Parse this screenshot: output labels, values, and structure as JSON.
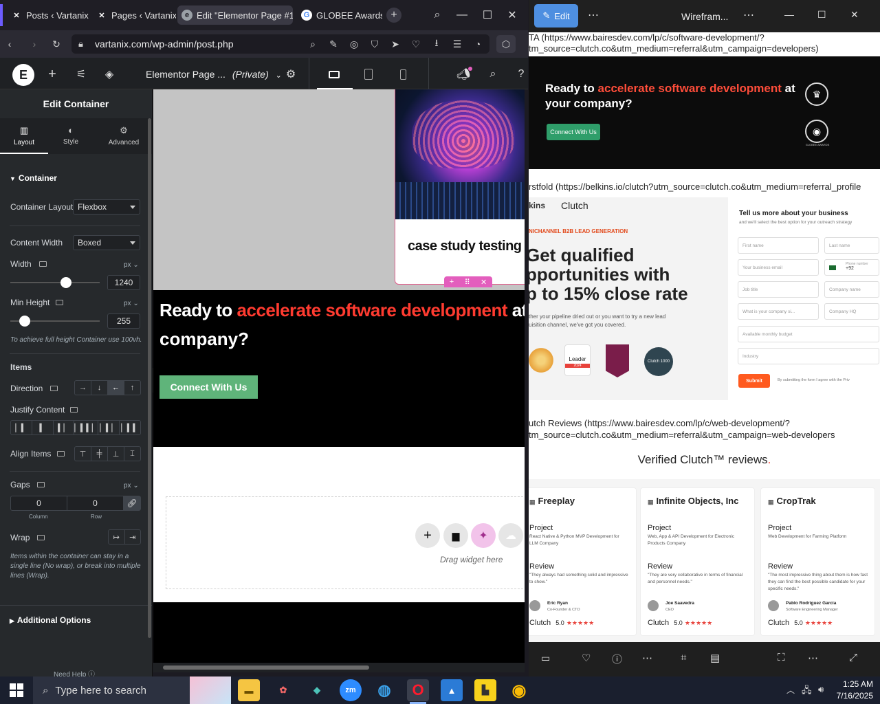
{
  "browser": {
    "tabs": [
      {
        "title": "Posts ‹ Vartanix —",
        "icon": "wordpress-icon"
      },
      {
        "title": "Pages ‹ Vartanix —",
        "icon": "wordpress-icon"
      },
      {
        "title": "Edit \"Elementor Page #10",
        "icon": "elementor-icon"
      },
      {
        "title": "GLOBEE Awards Ir",
        "icon": "google-icon"
      }
    ],
    "url": "vartanix.com/wp-admin/post.php"
  },
  "elementor": {
    "page_title": "Elementor Page ...",
    "page_status": "(Private)",
    "panel": {
      "title": "Edit Container",
      "tabs": [
        "Layout",
        "Style",
        "Advanced"
      ],
      "section": "Container",
      "container_layout_label": "Container Layout",
      "container_layout_value": "Flexbox",
      "content_width_label": "Content Width",
      "content_width_value": "Boxed",
      "width_label": "Width",
      "width_unit": "px",
      "width_value": "1240",
      "width_fraction": 0.62,
      "min_height_label": "Min Height",
      "min_height_unit": "px",
      "min_height_value": "255",
      "min_height_fraction": 0.16,
      "min_height_hint": "To achieve full height Container use 100vh.",
      "items_heading": "Items",
      "direction_label": "Direction",
      "justify_label": "Justify Content",
      "align_label": "Align Items",
      "gaps_label": "Gaps",
      "gaps_unit": "px",
      "gap_column": "0",
      "gap_row": "0",
      "gap_column_label": "Column",
      "gap_row_label": "Row",
      "wrap_label": "Wrap",
      "wrap_hint": "Items within the container can stay in a single line (No wrap), or break into multiple lines (Wrap).",
      "additional_options": "Additional Options",
      "need_help": "Need Help"
    },
    "canvas": {
      "card_title": "case study testing",
      "cta_heading_pre": "Ready to ",
      "cta_heading_highlight": "accelerate software development",
      "cta_heading_post": " at y",
      "cta_heading_line2": "company?",
      "cta_button": "Connect With Us",
      "drag_hint": "Drag widget here"
    }
  },
  "viewer": {
    "title": "Wirefram...",
    "edit_label": "Edit",
    "cta_url_1": "TA (https://www.bairesdev.com/lp/c/software-development/?",
    "cta_url_2": "tm_source=clutch.co&utm_medium=referral&utm_campaign=developers)",
    "cta_heading_pre": "Ready to ",
    "cta_heading_highlight": "accelerate software development",
    "cta_heading_post": " at",
    "cta_heading_line2": "your company?",
    "cta_button": "Connect With Us",
    "globee_label": "GLOBEE AWARDS",
    "firstfold_url": "rstfold (https://belkins.io/clutch?utm_source=clutch.co&utm_medium=referral_profile",
    "brand": "Clutch",
    "brand_prefix": "kins",
    "eyebrow": "NICHANNEL B2B LEAD GENERATION",
    "hero_1": "Get qualified",
    "hero_2": "pportunities with",
    "hero_3": "p to 15% close rate",
    "hero_sub_1": "ther your pipeline dried out or you want to try a new lead",
    "hero_sub_2": "uisition channel, we've got you covered.",
    "badge_leader": "Leader",
    "badge_year": "2024",
    "badge_clutch": "Clutch 1000",
    "form_title": "Tell us more about your business",
    "form_sub": "and we'll select the best option for your outreach strategy",
    "form_fields": [
      "First name",
      "Last name",
      "Your business email",
      "Phone number",
      "Job title",
      "Company name",
      "What is your company si...",
      "Company HQ",
      "Available monthly budget",
      "Industry"
    ],
    "phone_code": "+92",
    "submit": "Submit",
    "consent": "By submitting the form I agree with the Priv",
    "reviews_url_1": "utch Reviews (https://www.bairesdev.com/lp/c/web-development/?",
    "reviews_url_2": "tm_source=clutch.co&utm_medium=referral&utm_campaign=web-developers",
    "reviews_heading": "Verified Clutch™ reviews",
    "reviews_dot": ".",
    "reviews": [
      {
        "company": "Freeplay",
        "project_label": "Project",
        "project": "React Native & Python MVP Development for LLM Company",
        "review_label": "Review",
        "review": "\"They always had something solid and impressive to show.\"",
        "name": "Eric Ryan",
        "role": "Co-Founder & CTO",
        "score": "5.0",
        "brand": "Clutch"
      },
      {
        "company": "Infinite Objects, Inc",
        "project_label": "Project",
        "project": "Web, App & API Development for Electronic Products Company",
        "review_label": "Review",
        "review": "\"They are very collaborative in terms of financial and personnel needs.\"",
        "name": "Joe Saavedra",
        "role": "CEO",
        "score": "5.0",
        "brand": "Clutch"
      },
      {
        "company": "CropTrak",
        "project_label": "Project",
        "project": "Web Development for Farming Platform",
        "review_label": "Review",
        "review": "\"The most impressive thing about them is how fast they can find the best possible candidate for your specific needs.\"",
        "name": "Pablo Rodriguez Garcia",
        "role": "Software Engineering Manager",
        "score": "5.0",
        "brand": "Clutch"
      }
    ],
    "stars": "★★★★★"
  },
  "taskbar": {
    "search_placeholder": "Type here to search",
    "time": "1:25 AM",
    "date": "7/16/2025"
  },
  "colors": {
    "accent_red": "#ff3b30",
    "cta_green": "#5fb47a",
    "viewer_cta_green": "#2f9e6a",
    "submit_orange": "#ff5a1f",
    "elementor_panel": "#26292c"
  }
}
